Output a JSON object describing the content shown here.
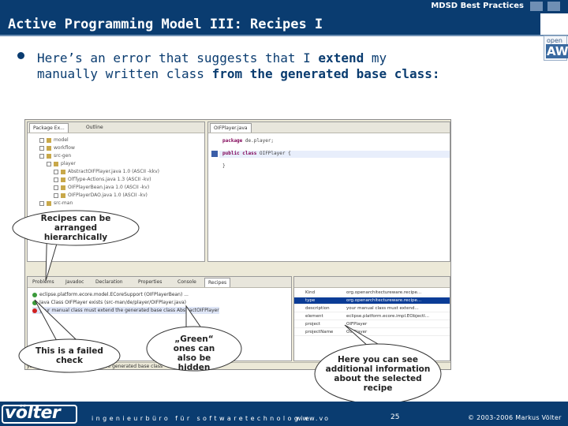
{
  "header": {
    "top_label": "MDSD Best Practices",
    "title": "Active Programming Model III: Recipes I"
  },
  "logo": {
    "small": "open",
    "big": "AW"
  },
  "bullet": {
    "parts": [
      {
        "text": "Here’s an error that suggests that I ",
        "bold": false
      },
      {
        "text": "extend",
        "bold": true
      },
      {
        "text": " my manually written class ",
        "bold": false
      },
      {
        "text": "from the generated base class:",
        "bold": true
      }
    ]
  },
  "screenshot": {
    "left_tabs": [
      "Package Ex...",
      "Outline"
    ],
    "editor_tab": "OIFPlayer.java",
    "tree": [
      {
        "label": "model",
        "indent": 1
      },
      {
        "label": "workflow",
        "indent": 1
      },
      {
        "label": "src-gen",
        "indent": 1
      },
      {
        "label": "player",
        "indent": 2
      },
      {
        "label": "AbstractOIFPlayer.java 1.0 (ASCII -kkv)",
        "indent": 3
      },
      {
        "label": "OlfType-Actions.java 1.3 (ASCII -kv)",
        "indent": 3
      },
      {
        "label": "OIFPlayerBean.java 1.0 (ASCII -kv)",
        "indent": 3
      },
      {
        "label": "OIFPlayerDAO.java 1.0 (ASCII -kv)",
        "indent": 3
      },
      {
        "label": "src-man",
        "indent": 1
      }
    ],
    "code": [
      {
        "kw": "package",
        "text": " de.player;"
      },
      {
        "kw": "public class",
        "text": " OIFPlayer {"
      },
      {
        "kw": "",
        "text": "}"
      }
    ],
    "bottom_tabs": [
      "Problems",
      "Javadoc",
      "Declaration",
      "Properties",
      "Console",
      "Recipes"
    ],
    "recipes": [
      {
        "text": "eclipse.platform.ecore.model.ECoreSupport (OIFPlayerBean) ...",
        "error": false,
        "selected": false
      },
      {
        "text": "Java Class OIFPlayer exists (src-man/de/player/OIFPlayer.java)",
        "error": false,
        "selected": false
      },
      {
        "text": "your manual class must extend the generated base class AbstractOIFPlayer",
        "error": true,
        "selected": true
      }
    ],
    "properties": [
      {
        "key": "Kind",
        "value": "org.openarchitectureware.recipe..."
      },
      {
        "key": "type",
        "value": "org.openarchitectureware.recipe..."
      },
      {
        "key": "description",
        "value": "your manual class must extend..."
      },
      {
        "key": "element",
        "value": "eclipse.platform.ecore.impl.EObjectI..."
      },
      {
        "key": "project",
        "value": "OIFPlayer"
      },
      {
        "key": "projectName",
        "value": "OIFPlayer"
      }
    ],
    "status": "your manual class must extend the generated base class"
  },
  "callouts": {
    "hierarchy": "Recipes can be arranged hierarchically",
    "failed": "This is a failed check",
    "green": "„Green“ ones can also be hidden",
    "info": "Here you can see additional information about the selected recipe"
  },
  "footer": {
    "logo": "völter",
    "tagline": "ingenieurbüro für softwaretechnologie",
    "url": "www.vo",
    "page": "25",
    "copyright": "© 2003-2006 Markus Völter"
  },
  "colors": {
    "brand_navy": "#0a3c70",
    "rule": "#6e8fb3",
    "error": "#d02020",
    "selection": "#0a3c96"
  }
}
